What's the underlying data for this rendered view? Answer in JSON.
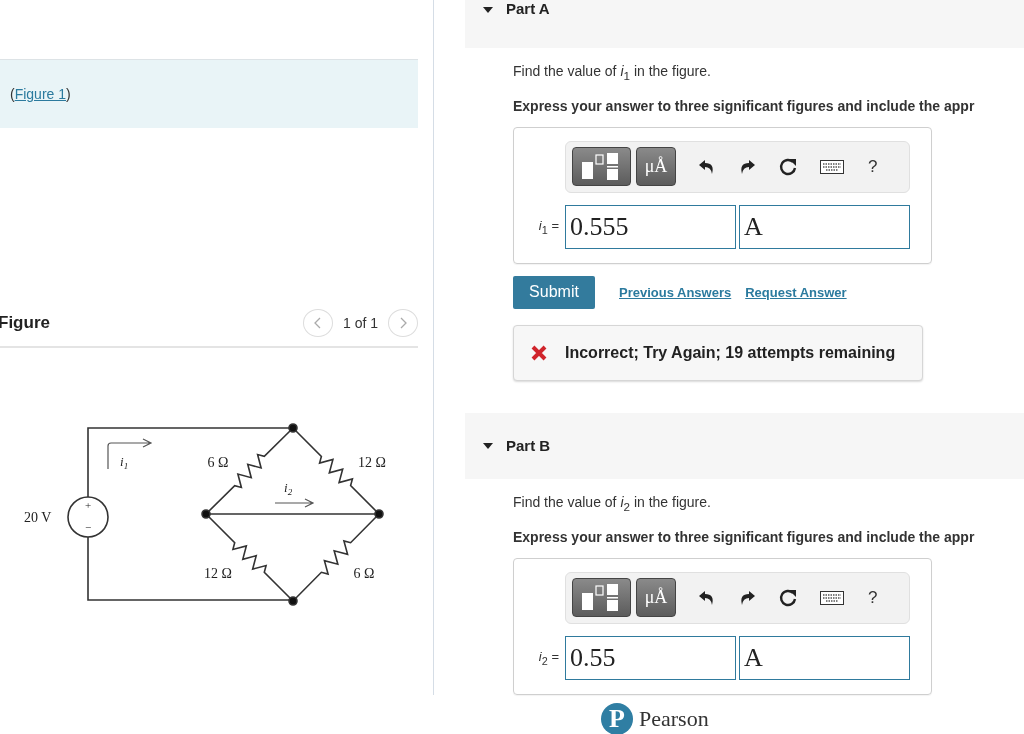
{
  "figure_reference": {
    "before": "(",
    "link": "Figure 1",
    "after": ")"
  },
  "figure_panel": {
    "title": "Figure",
    "pager": "1 of 1"
  },
  "circuit": {
    "source": "20 V",
    "polarity": [
      "+",
      "−"
    ],
    "resistors": [
      "6 Ω",
      "12 Ω",
      "12 Ω",
      "6 Ω"
    ],
    "currents": [
      {
        "symbol": "i",
        "sub": "1"
      },
      {
        "symbol": "i",
        "sub": "2"
      }
    ]
  },
  "parts": [
    {
      "title": "Part A",
      "expanded": true,
      "question": "Find the value of *i*$_{1}$ in the figure.",
      "instruction": "Express your answer to three significant figures and include the appr",
      "toolbar": {
        "units": "μÅ",
        "help": "?"
      },
      "variable": "*i*$_{1}$ =",
      "value": "0.555",
      "unit": "A",
      "actions": {
        "submit": "Submit",
        "links": [
          "Previous Answers",
          "Request Answer"
        ]
      },
      "feedback": {
        "kind": "incorrect",
        "text": "Incorrect; Try Again; 19 attempts remaining"
      }
    },
    {
      "title": "Part B",
      "expanded": true,
      "question": "Find the value of *i*$_{2}$ in the figure.",
      "instruction": "Express your answer to three significant figures and include the appr",
      "toolbar": {
        "units": "μÅ",
        "help": "?"
      },
      "variable": "*i*$_{2}$ =",
      "value": "0.55",
      "unit": "A"
    }
  ],
  "logo": {
    "mark": "P",
    "name": "Pearson"
  }
}
